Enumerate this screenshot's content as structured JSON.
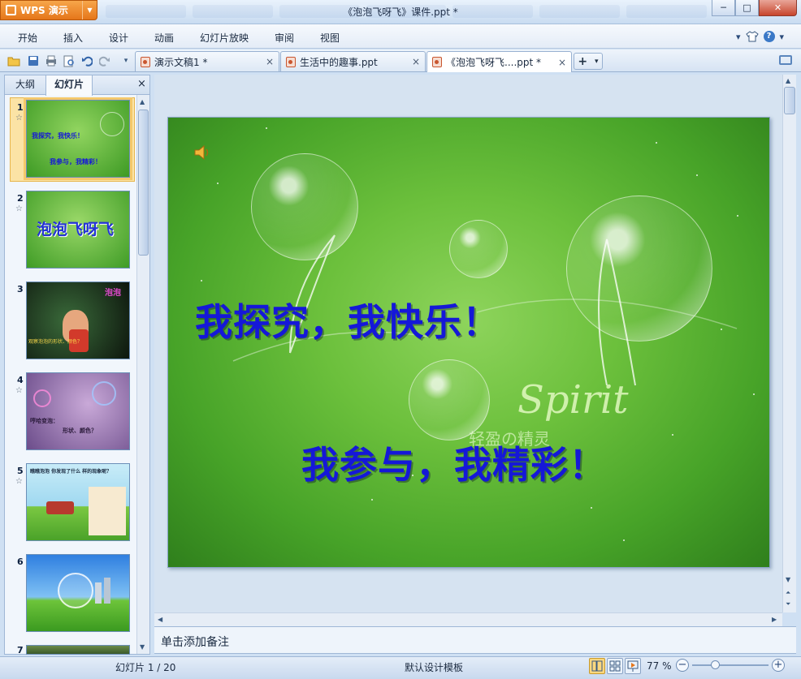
{
  "app": {
    "brand": "WPS 演示",
    "doc_title": "《泡泡飞呀飞》课件.ppt *"
  },
  "window_controls": {
    "minimize": "─",
    "maximize": "□",
    "close": "✕"
  },
  "menu": [
    "开始",
    "插入",
    "设计",
    "动画",
    "幻灯片放映",
    "审阅",
    "视图"
  ],
  "menu_right": {
    "dropdown": "▾",
    "help": "?"
  },
  "doc_tabs": [
    {
      "label": "演示文稿1 *",
      "close": "×"
    },
    {
      "label": "生活中的趣事.ppt",
      "close": "×"
    },
    {
      "label": "《泡泡飞呀飞....ppt *",
      "close": "×"
    }
  ],
  "new_tab": {
    "plus": "+",
    "dropdown": "▾"
  },
  "side_panel": {
    "tabs": [
      "大纲",
      "幻灯片"
    ],
    "active_tab": "幻灯片",
    "close": "×",
    "thumbnails": [
      {
        "num": "1",
        "star": "☆",
        "lines": [
          "我探究，我快乐！",
          "我参与，我精彩！"
        ]
      },
      {
        "num": "2",
        "star": "☆",
        "lines": [
          "泡泡飞呀飞"
        ]
      },
      {
        "num": "3",
        "star": "",
        "lines": [
          "泡泡",
          "观察泡泡的形状、颜色？"
        ]
      },
      {
        "num": "4",
        "star": "☆",
        "lines": [
          "哼哈变泡：",
          "形状、颜色？"
        ]
      },
      {
        "num": "5",
        "star": "☆",
        "lines": [
          "瞧瞧泡泡 你发现了什么 样的现象呢？"
        ]
      },
      {
        "num": "6",
        "star": "",
        "lines": []
      },
      {
        "num": "7",
        "star": "",
        "lines": []
      }
    ]
  },
  "slide": {
    "line1": "我探究，我快乐！",
    "line2": "我参与，我精彩！",
    "decor_word": "Spirit",
    "decor_sub": "轻盈の精灵"
  },
  "notes_placeholder": "单击添加备注",
  "status": {
    "slide_counter": "幻灯片 1 / 20",
    "theme": "默认设计模板",
    "zoom": "77 %",
    "zoom_level": 0.3,
    "zoom_minus": "−",
    "zoom_plus": "+"
  },
  "colors": {
    "slide_text": "#1518d8",
    "wps_orange": "#e5761a",
    "selection": "#f4c86a"
  }
}
